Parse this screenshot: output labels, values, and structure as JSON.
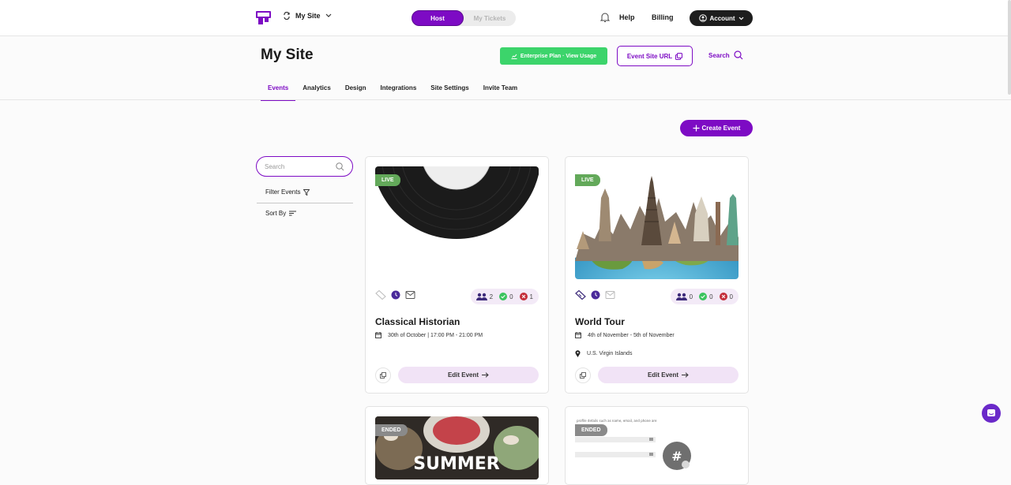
{
  "header": {
    "site_name": "My Site",
    "toggle": [
      "Host",
      "My Tickets"
    ],
    "help": "Help",
    "billing": "Billing",
    "account": "Account"
  },
  "page": {
    "title": "My Site",
    "enterprise_label": "Enterprise Plan · View Usage",
    "site_url_label": "Event Site URL",
    "search_label": "Search"
  },
  "tabs": [
    "Events",
    "Analytics",
    "Design",
    "Integrations",
    "Site Settings",
    "Invite Team"
  ],
  "create_label": "Create Event",
  "sidebar": {
    "search_placeholder": "Search",
    "filter_label": "Filter Events",
    "sort_label": "Sort By"
  },
  "colors": {
    "accent": "#7d0bc4",
    "live": "#63a95a",
    "enterprise": "#3cd46b"
  },
  "cards": [
    {
      "status": "LIVE",
      "title": "Classical Historian",
      "date": "30th of October | 17:00 PM - 21:00 PM",
      "stats": {
        "registered": "2",
        "approved": "0",
        "declined": "1"
      },
      "edit_label": "Edit Event"
    },
    {
      "status": "LIVE",
      "title": "World Tour",
      "date": "4th of November - 5th of November",
      "location": "U.S. Virgin Islands",
      "stats": {
        "registered": "0",
        "approved": "0",
        "declined": "0"
      },
      "edit_label": "Edit Event"
    },
    {
      "status": "ENDED",
      "image_text": "SUMMER"
    },
    {
      "status": "ENDED",
      "image_text": "#",
      "image_caption": "profile details such as name, email, and phone are"
    }
  ]
}
